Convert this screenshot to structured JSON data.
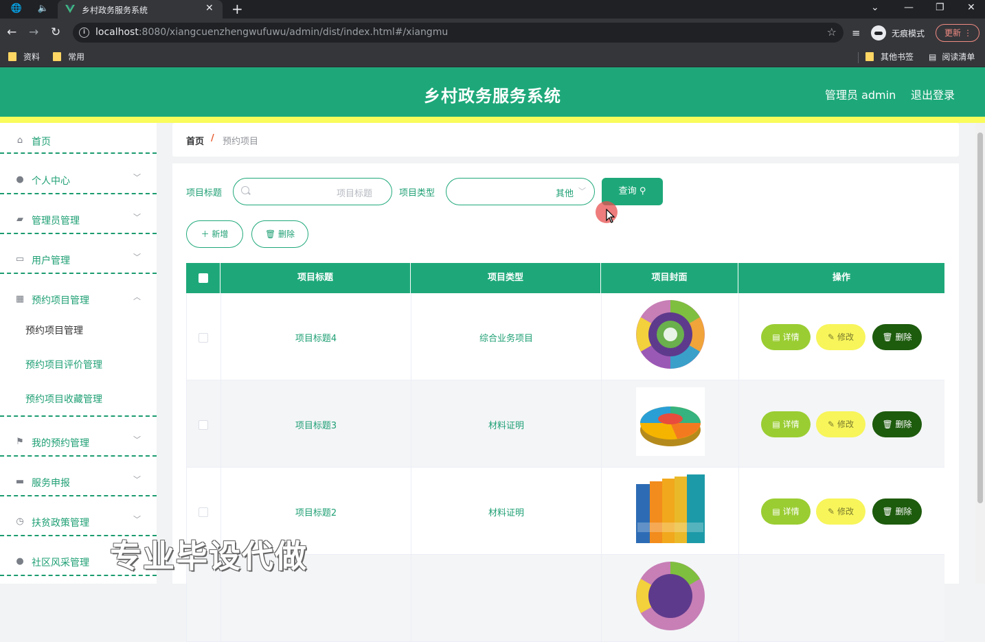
{
  "browser": {
    "tab_title": "乡村政务服务系统",
    "url_host": "localhost",
    "url_rest": ":8080/xiangcuenzhengwufuwu/admin/dist/index.html#/xiangmu",
    "incognito_label": "无痕模式",
    "update_label": "更新",
    "bookmarks": [
      "资料",
      "常用"
    ],
    "other_bookmarks": "其他书签",
    "reading_list": "阅读清单"
  },
  "header": {
    "title": "乡村政务服务系统",
    "admin": "管理员 admin",
    "logout": "退出登录",
    "accent_color": "#1ea87a",
    "stripe_color": "#f9fc5b"
  },
  "sidebar": {
    "items": [
      {
        "label": "首页",
        "icon": "home-icon"
      },
      {
        "label": "个人中心",
        "icon": "user-icon"
      },
      {
        "label": "管理员管理",
        "icon": "briefcase-icon"
      },
      {
        "label": "用户管理",
        "icon": "chat-icon"
      },
      {
        "label": "预约项目管理",
        "icon": "grid-icon"
      },
      {
        "label": "我的预约管理",
        "icon": "flag-icon"
      },
      {
        "label": "服务申报",
        "icon": "message-icon"
      },
      {
        "label": "扶贫政策管理",
        "icon": "clock-icon"
      },
      {
        "label": "社区风采管理",
        "icon": "group-icon"
      }
    ],
    "sub_items": [
      "预约项目管理",
      "预约项目评价管理",
      "预约项目收藏管理"
    ]
  },
  "breadcrumb": {
    "home": "首页",
    "sep": "/",
    "current": "预约项目"
  },
  "filters": {
    "title_label": "项目标题",
    "title_placeholder": "项目标题",
    "type_label": "项目类型",
    "type_value": "其他",
    "query_label": "查询"
  },
  "toolbar": {
    "add_label": "新增",
    "delete_label": "删除"
  },
  "table": {
    "headers": [
      "项目标题",
      "项目类型",
      "项目封面",
      "操作"
    ],
    "rows": [
      {
        "title": "项目标题4",
        "type": "综合业务项目",
        "cover": "wheel"
      },
      {
        "title": "项目标题3",
        "type": "材料证明",
        "cover": "pie"
      },
      {
        "title": "项目标题2",
        "type": "材料证明",
        "cover": "books"
      },
      {
        "title": "",
        "type": "",
        "cover": "wheel"
      }
    ],
    "actions": {
      "detail": "详情",
      "edit": "修改",
      "delete": "删除"
    }
  },
  "watermark": "专业毕设代做"
}
